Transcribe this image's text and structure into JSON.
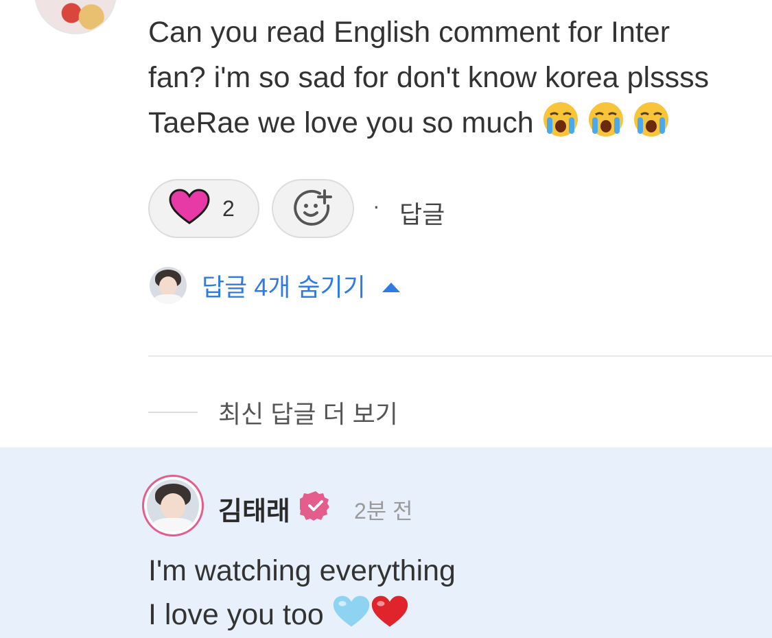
{
  "comment": {
    "text": "Can you read English comment for Inter\nfan? i'm so sad for don't know korea plssss\nTaeRae we love you so much",
    "emojis": [
      "loudly-crying-face-icon",
      "loudly-crying-face-icon",
      "loudly-crying-face-icon"
    ],
    "like_count": "2",
    "separator": "·",
    "reply_label": "답글"
  },
  "replies_toggle": {
    "label": "답글 4개 숨기기"
  },
  "more_replies": {
    "label": "최신 답글 더 보기"
  },
  "author_reply": {
    "author": "김태래",
    "time": "2분 전",
    "text_line1": "I'm watching everything",
    "text_line2": "I love you too"
  },
  "colors": {
    "heart": "#e83aa6",
    "link_blue": "#2f7be6",
    "highlight_bg": "#e8f1fb",
    "verified_pink": "#e45e8d",
    "avatar_ring": "#e45e8d"
  }
}
